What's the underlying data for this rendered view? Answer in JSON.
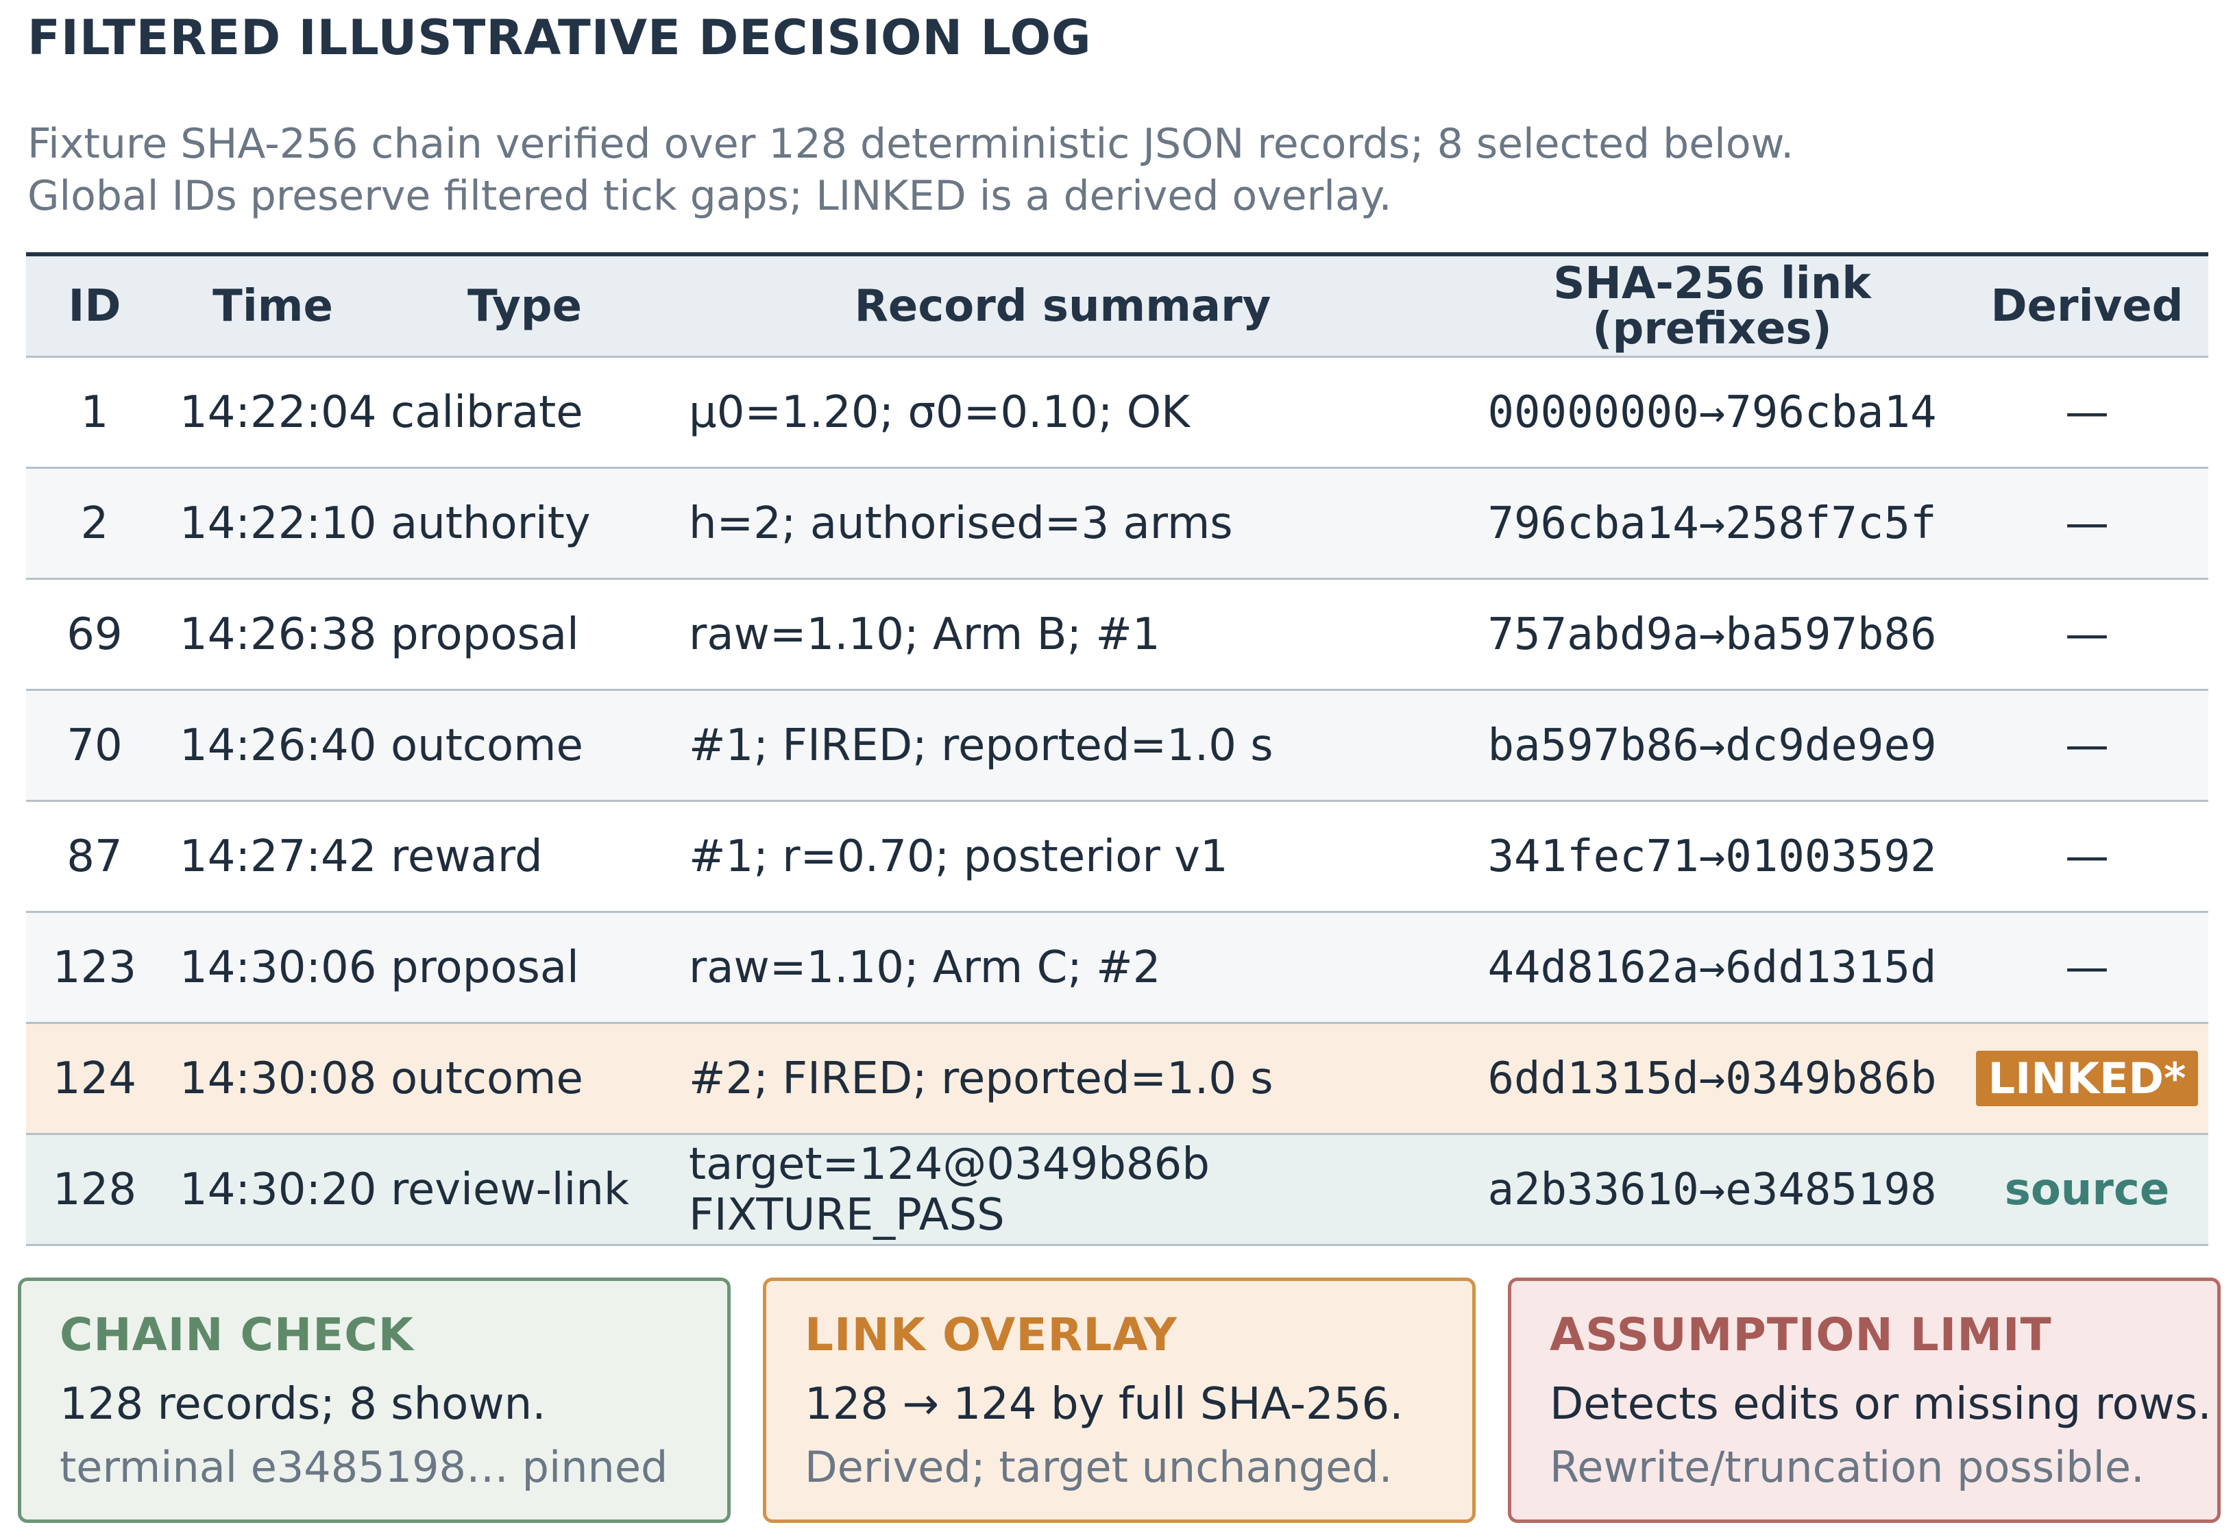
{
  "title": "FILTERED ILLUSTRATIVE DECISION LOG",
  "subtitle_lines": [
    "Fixture SHA-256 chain verified over 128 deterministic JSON records; 8 selected below.",
    "Global IDs preserve filtered tick gaps; LINKED is a derived overlay."
  ],
  "table": {
    "headers": {
      "id": "ID",
      "time": "Time",
      "type": "Type",
      "summary": "Record summary",
      "hash_line1": "SHA-256 link",
      "hash_line2": "(prefixes)",
      "derived": "Derived"
    },
    "rows": [
      {
        "id": "1",
        "time": "14:22:04",
        "type": "calibrate",
        "summary": "μ0=1.20; σ0=0.10; OK",
        "hash": "00000000→796cba14",
        "derived": "—"
      },
      {
        "id": "2",
        "time": "14:22:10",
        "type": "authority",
        "summary": "h=2; authorised=3 arms",
        "hash": "796cba14→258f7c5f",
        "derived": "—"
      },
      {
        "id": "69",
        "time": "14:26:38",
        "type": "proposal",
        "summary": "raw=1.10; Arm B; #1",
        "hash": "757abd9a→ba597b86",
        "derived": "—"
      },
      {
        "id": "70",
        "time": "14:26:40",
        "type": "outcome",
        "summary": "#1; FIRED; reported=1.0 s",
        "hash": "ba597b86→dc9de9e9",
        "derived": "—"
      },
      {
        "id": "87",
        "time": "14:27:42",
        "type": "reward",
        "summary": "#1; r=0.70; posterior v1",
        "hash": "341fec71→01003592",
        "derived": "—"
      },
      {
        "id": "123",
        "time": "14:30:06",
        "type": "proposal",
        "summary": "raw=1.10; Arm C; #2",
        "hash": "44d8162a→6dd1315d",
        "derived": "—"
      },
      {
        "id": "124",
        "time": "14:30:08",
        "type": "outcome",
        "summary": "#2; FIRED; reported=1.0 s",
        "hash": "6dd1315d→0349b86b",
        "derived": "LINKED*"
      },
      {
        "id": "128",
        "time": "14:30:20",
        "type": "review-link",
        "summary_line1": "target=124@0349b86b",
        "summary_line2": "FIXTURE_PASS",
        "hash": "a2b33610→e3485198",
        "derived": "source"
      }
    ]
  },
  "cards": [
    {
      "heading": "CHAIN CHECK",
      "line1": "128 records; 8 shown.",
      "line2": "terminal e3485198… pinned",
      "color": "#5f8a6a",
      "bg": "#edf2ed",
      "border": "#6e9478"
    },
    {
      "heading": "LINK OVERLAY",
      "line1": "128 → 124 by full SHA-256.",
      "line2": "Derived; target unchanged.",
      "color": "#c97f30",
      "bg": "#fbeee0",
      "border": "#d1924a"
    },
    {
      "heading": "ASSUMPTION LIMIT",
      "line1": "Detects edits or missing rows.",
      "line2": "Rewrite/truncation possible.",
      "color": "#a65b57",
      "bg": "#f8e8e8",
      "border": "#b46b66"
    }
  ]
}
